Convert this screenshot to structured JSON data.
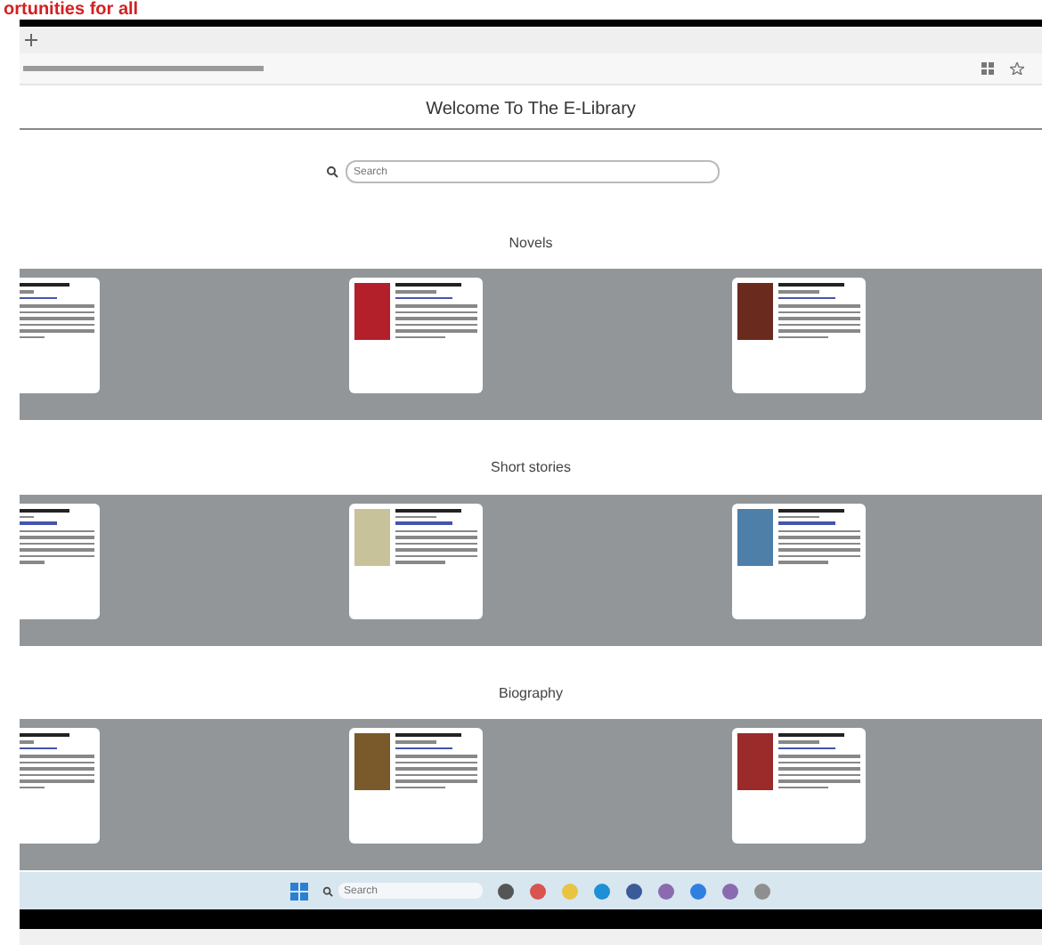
{
  "banner": {
    "text": "ortunities for all"
  },
  "page": {
    "title": "Welcome To The E-Library",
    "search": {
      "placeholder": "Search"
    }
  },
  "sections": [
    {
      "heading": "Novels",
      "books": [
        {
          "kind": "cropped"
        },
        {
          "kind": "full",
          "color": "#b3202a"
        },
        {
          "kind": "full",
          "color": "#6a2a1e"
        }
      ]
    },
    {
      "heading": "Short stories",
      "books": [
        {
          "kind": "cropped"
        },
        {
          "kind": "full",
          "color": "#c8c29a"
        },
        {
          "kind": "full",
          "color": "#4d7fa8"
        }
      ]
    },
    {
      "heading": "Biography",
      "books": [
        {
          "kind": "cropped"
        },
        {
          "kind": "full",
          "color": "#7a5a2a"
        },
        {
          "kind": "full",
          "color": "#9b2a2a"
        }
      ]
    }
  ],
  "taskbar": {
    "search": {
      "placeholder": "Search"
    }
  }
}
